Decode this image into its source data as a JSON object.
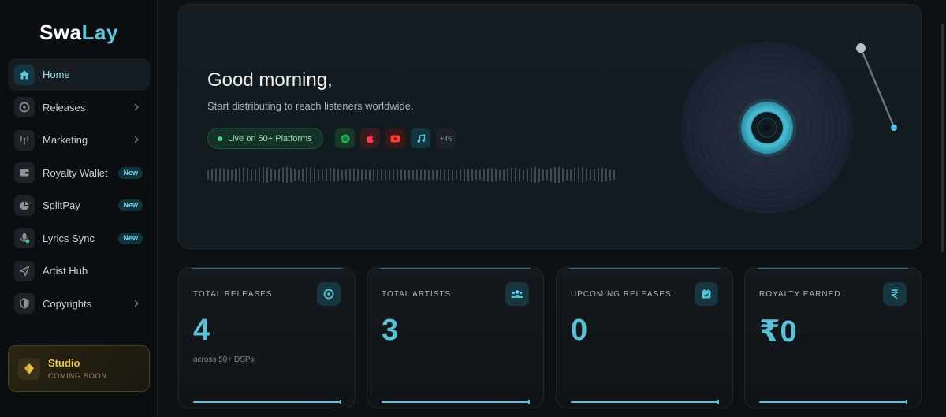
{
  "brand": {
    "part1": "Swa",
    "part2": "Lay"
  },
  "sidebar": {
    "items": [
      {
        "label": "Home",
        "icon": "home-icon",
        "active": true
      },
      {
        "label": "Releases",
        "icon": "disc-icon",
        "chevron": true
      },
      {
        "label": "Marketing",
        "icon": "broadcast-icon",
        "chevron": true
      },
      {
        "label": "Royalty Wallet",
        "icon": "wallet-icon",
        "badge": "New"
      },
      {
        "label": "SplitPay",
        "icon": "pie-chart-icon",
        "badge": "New"
      },
      {
        "label": "Lyrics Sync",
        "icon": "microphone-icon",
        "badge": "New"
      },
      {
        "label": "Artist Hub",
        "icon": "send-icon"
      },
      {
        "label": "Copyrights",
        "icon": "shield-icon",
        "chevron": true
      }
    ],
    "studio": {
      "title": "Studio",
      "subtitle": "COMING SOON",
      "icon": "diamond-icon"
    }
  },
  "hero": {
    "greeting": "Good morning,",
    "subtext": "Start distributing to reach listeners worldwide.",
    "live_label": "Live on 50+ Platforms",
    "platforms": [
      {
        "name": "spotify-icon",
        "color": "#1db954"
      },
      {
        "name": "apple-music-icon",
        "color": "#fa3c4c"
      },
      {
        "name": "youtube-icon",
        "color": "#ff3b30"
      },
      {
        "name": "music-note-icon",
        "color": "#5ec6dc"
      }
    ],
    "more_platforms": "+46"
  },
  "stats": [
    {
      "label": "TOTAL RELEASES",
      "value": "4",
      "sub": "across 50+ DSPs",
      "icon": "disc-icon"
    },
    {
      "label": "TOTAL ARTISTS",
      "value": "3",
      "sub": "",
      "icon": "users-icon"
    },
    {
      "label": "UPCOMING RELEASES",
      "value": "0",
      "sub": "",
      "icon": "calendar-icon"
    },
    {
      "label": "ROYALTY EARNED",
      "value": "₹0",
      "sub": "",
      "icon": "rupee-icon"
    }
  ],
  "colors": {
    "accent": "#5cc0d6",
    "background": "#0d1114",
    "studio_gold": "#f1c24a"
  }
}
